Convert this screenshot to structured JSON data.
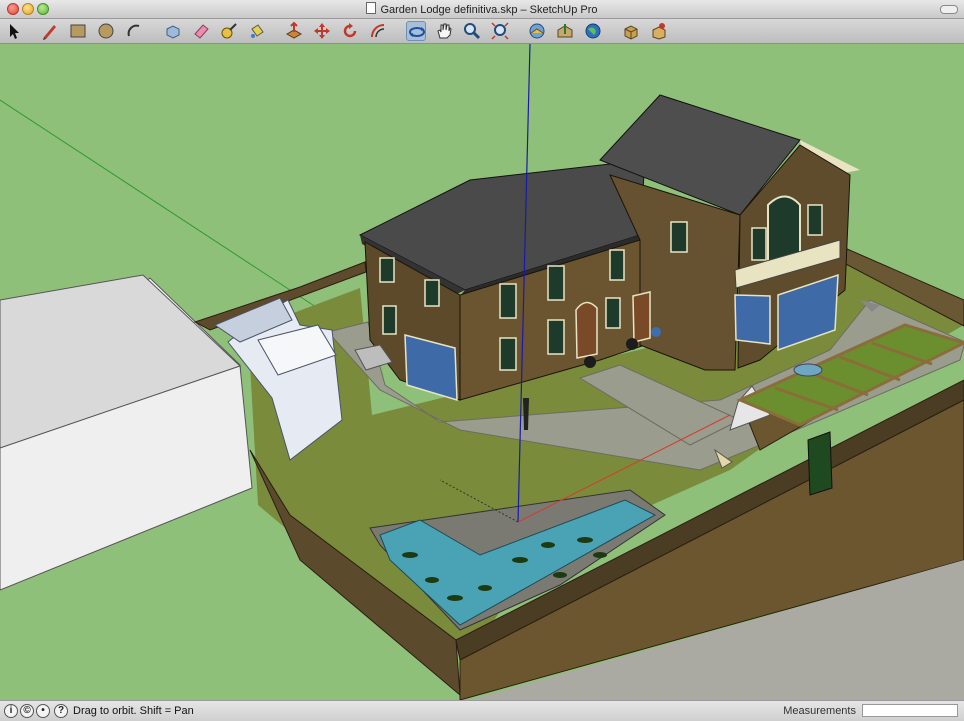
{
  "window": {
    "title": "Garden Lodge definitiva.skp – SketchUp Pro",
    "buttons": [
      "close",
      "minimize",
      "zoom"
    ]
  },
  "toolbar": {
    "tools": [
      {
        "name": "select-tool",
        "icon": "arrow-cursor-icon",
        "selected": false
      },
      {
        "name": "line-tool",
        "icon": "pencil-icon",
        "selected": false
      },
      {
        "name": "rectangle-tool",
        "icon": "rectangle-icon",
        "selected": false
      },
      {
        "name": "circle-tool",
        "icon": "circle-icon",
        "selected": false
      },
      {
        "name": "arc-tool",
        "icon": "arc-icon",
        "selected": false
      },
      {
        "name": "make-component-tool",
        "icon": "component-icon",
        "selected": false
      },
      {
        "name": "eraser-tool",
        "icon": "eraser-icon",
        "selected": false
      },
      {
        "name": "tape-measure-tool",
        "icon": "tape-measure-icon",
        "selected": false
      },
      {
        "name": "paint-bucket-tool",
        "icon": "paint-bucket-icon",
        "selected": false
      },
      {
        "name": "push-pull-tool",
        "icon": "push-pull-icon",
        "selected": false
      },
      {
        "name": "move-tool",
        "icon": "move-icon",
        "selected": false
      },
      {
        "name": "rotate-tool",
        "icon": "rotate-icon",
        "selected": false
      },
      {
        "name": "offset-tool",
        "icon": "offset-icon",
        "selected": false
      },
      {
        "name": "orbit-tool",
        "icon": "orbit-icon",
        "selected": true
      },
      {
        "name": "pan-tool",
        "icon": "hand-icon",
        "selected": false
      },
      {
        "name": "zoom-tool",
        "icon": "magnifier-icon",
        "selected": false
      },
      {
        "name": "zoom-extents-tool",
        "icon": "zoom-extents-icon",
        "selected": false
      },
      {
        "name": "get-models-tool",
        "icon": "globe-warehouse-icon",
        "selected": false
      },
      {
        "name": "share-model-tool",
        "icon": "share-icon",
        "selected": false
      },
      {
        "name": "google-earth-tool",
        "icon": "google-earth-icon",
        "selected": false
      },
      {
        "name": "components-tool",
        "icon": "components-box-icon",
        "selected": false
      },
      {
        "name": "extension-warehouse-tool",
        "icon": "extension-icon",
        "selected": false
      }
    ]
  },
  "viewport": {
    "ground_color": "#8fc07a",
    "axis_colors": {
      "red": "#d43c2c",
      "green": "#2f9a2f",
      "blue": "#1a1aa8"
    }
  },
  "statusbar": {
    "icons": [
      "info-icon",
      "credit-icon",
      "user-icon",
      "help-icon"
    ],
    "hint": "Drag to orbit.  Shift = Pan",
    "measurements_label": "Measurements",
    "measurements_value": ""
  }
}
